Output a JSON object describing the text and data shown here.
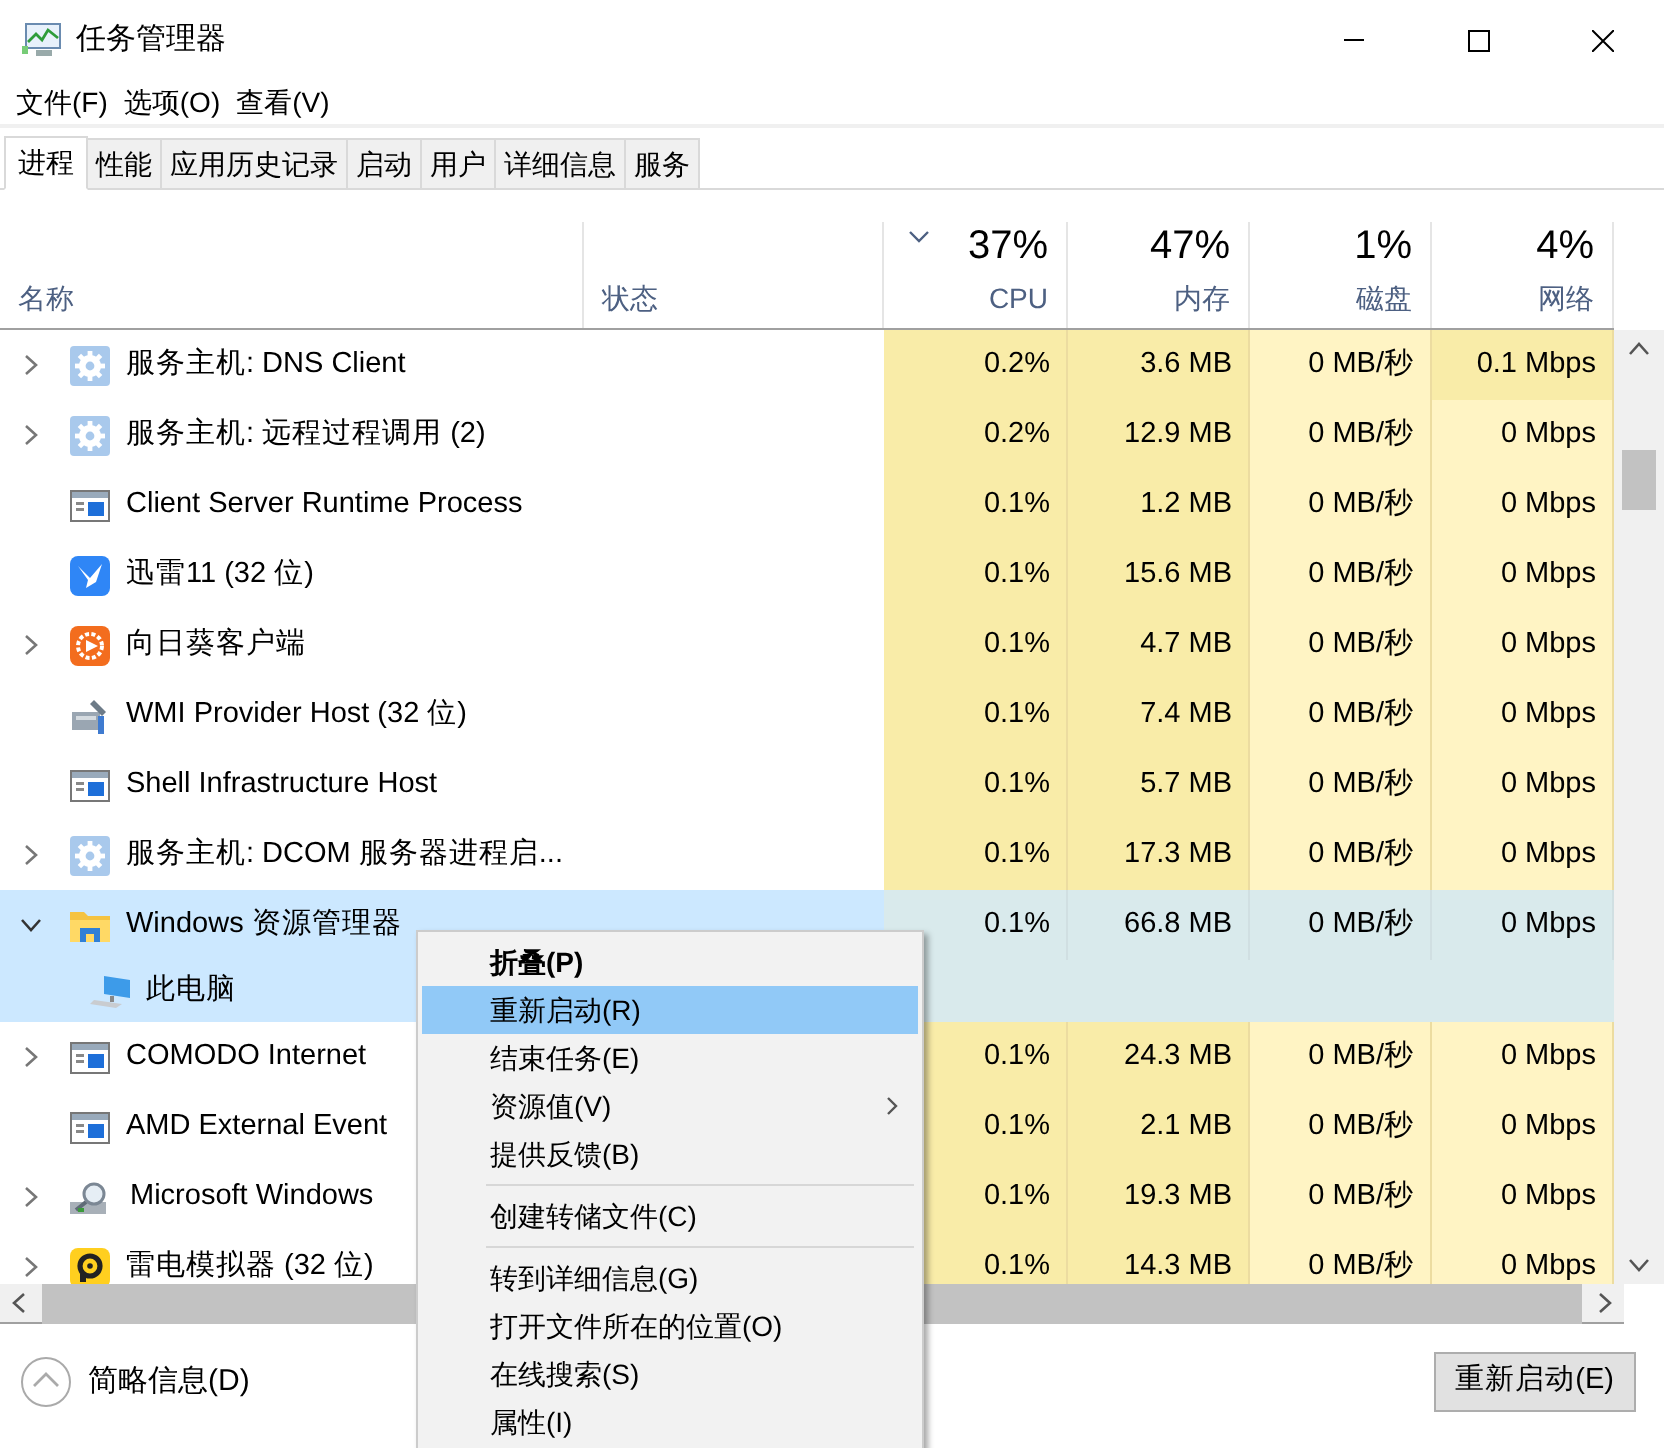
{
  "window": {
    "title": "任务管理器"
  },
  "menu_bar": [
    "文件(F)",
    "选项(O)",
    "查看(V)"
  ],
  "tabs": [
    {
      "label": "进程",
      "selected": true
    },
    {
      "label": "性能",
      "selected": false
    },
    {
      "label": "应用历史记录",
      "selected": false
    },
    {
      "label": "启动",
      "selected": false
    },
    {
      "label": "用户",
      "selected": false
    },
    {
      "label": "详细信息",
      "selected": false
    },
    {
      "label": "服务",
      "selected": false
    }
  ],
  "columns": [
    {
      "label": "名称"
    },
    {
      "label": "状态"
    },
    {
      "label": "CPU",
      "total": "37%",
      "sorted": true
    },
    {
      "label": "内存",
      "total": "47%",
      "sorted": false
    },
    {
      "label": "磁盘",
      "total": "1%",
      "sorted": false
    },
    {
      "label": "网络",
      "total": "4%",
      "sorted": false
    }
  ],
  "rows": [
    {
      "expanded": false,
      "kind": "gear",
      "name": "服务主机: DNS Client",
      "cpu": "0.2%",
      "memory": "3.6 MB",
      "disk": "0 MB/秒",
      "network": "0.1 Mbps",
      "selected": false,
      "network_high": true
    },
    {
      "expanded": false,
      "kind": "gear",
      "name": "服务主机: 远程过程调用 (2)",
      "cpu": "0.2%",
      "memory": "12.9 MB",
      "disk": "0 MB/秒",
      "network": "0 Mbps",
      "selected": false,
      "network_high": false
    },
    {
      "kind": "window",
      "name": "Client Server Runtime Process",
      "cpu": "0.1%",
      "memory": "1.2 MB",
      "disk": "0 MB/秒",
      "network": "0 Mbps",
      "selected": false,
      "network_high": false
    },
    {
      "kind": "bird",
      "name": "迅雷11 (32 位)",
      "cpu": "0.1%",
      "memory": "15.6 MB",
      "disk": "0 MB/秒",
      "network": "0 Mbps",
      "selected": false,
      "network_high": false
    },
    {
      "expanded": false,
      "kind": "flower",
      "name": "向日葵客户端",
      "cpu": "0.1%",
      "memory": "4.7 MB",
      "disk": "0 MB/秒",
      "network": "0 Mbps",
      "selected": false,
      "network_high": false
    },
    {
      "kind": "tool",
      "name": "WMI Provider Host (32 位)",
      "cpu": "0.1%",
      "memory": "7.4 MB",
      "disk": "0 MB/秒",
      "network": "0 Mbps",
      "selected": false,
      "network_high": false
    },
    {
      "kind": "window",
      "name": "Shell Infrastructure Host",
      "cpu": "0.1%",
      "memory": "5.7 MB",
      "disk": "0 MB/秒",
      "network": "0 Mbps",
      "selected": false,
      "network_high": false
    },
    {
      "expanded": false,
      "kind": "gear",
      "name": "服务主机: DCOM 服务器进程启...",
      "cpu": "0.1%",
      "memory": "17.3 MB",
      "disk": "0 MB/秒",
      "network": "0 Mbps",
      "selected": false,
      "network_high": false
    },
    {
      "expanded": true,
      "kind": "folder",
      "name": "Windows 资源管理器",
      "cpu": "0.1%",
      "memory": "66.8 MB",
      "disk": "0 MB/秒",
      "network": "0 Mbps",
      "selected": true,
      "network_high": false,
      "children": [
        {
          "kind": "monitor",
          "name": "此电脑"
        }
      ]
    },
    {
      "expanded": false,
      "kind": "window",
      "name": "COMODO Internet",
      "cpu": "0.1%",
      "memory": "24.3 MB",
      "disk": "0 MB/秒",
      "network": "0 Mbps",
      "selected": false,
      "network_high": false
    },
    {
      "kind": "window",
      "name": "AMD External Event",
      "cpu": "0.1%",
      "memory": "2.1 MB",
      "disk": "0 MB/秒",
      "network": "0 Mbps",
      "selected": false,
      "network_high": false
    },
    {
      "expanded": false,
      "kind": "magnifier",
      "name": "Microsoft Windows",
      "cpu": "0.1%",
      "memory": "19.3 MB",
      "disk": "0 MB/秒",
      "network": "0 Mbps",
      "selected": false,
      "network_high": false
    },
    {
      "expanded": false,
      "kind": "ring",
      "name": "雷电模拟器 (32 位)",
      "cpu": "0.1%",
      "memory": "14.3 MB",
      "disk": "0 MB/秒",
      "network": "0 Mbps",
      "selected": false,
      "network_high": false
    }
  ],
  "context_menu": [
    {
      "kind": "item",
      "label": "折叠(P)",
      "bold": true,
      "selected": false,
      "submenu": false
    },
    {
      "kind": "item",
      "label": "重新启动(R)",
      "bold": false,
      "selected": true,
      "submenu": false
    },
    {
      "kind": "item",
      "label": "结束任务(E)",
      "bold": false,
      "selected": false,
      "submenu": false
    },
    {
      "kind": "item",
      "label": "资源值(V)",
      "bold": false,
      "selected": false,
      "submenu": true
    },
    {
      "kind": "item",
      "label": "提供反馈(B)",
      "bold": false,
      "selected": false,
      "submenu": false
    },
    {
      "kind": "separator"
    },
    {
      "kind": "item",
      "label": "创建转储文件(C)",
      "bold": false,
      "selected": false,
      "submenu": false
    },
    {
      "kind": "separator"
    },
    {
      "kind": "item",
      "label": "转到详细信息(G)",
      "bold": false,
      "selected": false,
      "submenu": false
    },
    {
      "kind": "item",
      "label": "打开文件所在的位置(O)",
      "bold": false,
      "selected": false,
      "submenu": false
    },
    {
      "kind": "item",
      "label": "在线搜索(S)",
      "bold": false,
      "selected": false,
      "submenu": false
    },
    {
      "kind": "item",
      "label": "属性(I)",
      "bold": false,
      "selected": false,
      "submenu": false
    }
  ],
  "footer": {
    "details_link": "简略信息(D)",
    "button": "重新启动(E)"
  }
}
